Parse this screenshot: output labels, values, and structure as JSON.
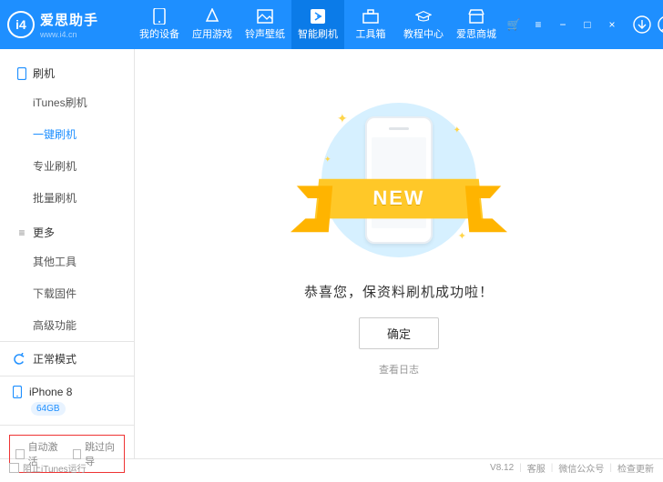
{
  "logo": {
    "mark": "i4",
    "title": "爱思助手",
    "sub": "www.i4.cn"
  },
  "tabs": [
    {
      "label": "我的设备"
    },
    {
      "label": "应用游戏"
    },
    {
      "label": "铃声壁纸"
    },
    {
      "label": "智能刷机",
      "active": true
    },
    {
      "label": "工具箱"
    },
    {
      "label": "教程中心"
    },
    {
      "label": "爱思商城"
    }
  ],
  "sidebar": {
    "section1": {
      "title": "刷机",
      "items": [
        {
          "label": "iTunes刷机"
        },
        {
          "label": "一键刷机",
          "active": true
        },
        {
          "label": "专业刷机"
        },
        {
          "label": "批量刷机"
        }
      ]
    },
    "section2": {
      "title": "更多",
      "items": [
        {
          "label": "其他工具"
        },
        {
          "label": "下载固件"
        },
        {
          "label": "高级功能"
        }
      ]
    },
    "status": "正常模式",
    "device": {
      "name": "iPhone 8",
      "storage": "64GB"
    },
    "opts": {
      "a": "自动激活",
      "b": "跳过向导"
    }
  },
  "main": {
    "ribbon": "NEW",
    "message": "恭喜您，保资料刷机成功啦！",
    "ok": "确定",
    "log": "查看日志"
  },
  "footer": {
    "block_itunes": "阻止iTunes运行",
    "version": "V8.12",
    "service": "客服",
    "wechat": "微信公众号",
    "update": "检查更新"
  }
}
